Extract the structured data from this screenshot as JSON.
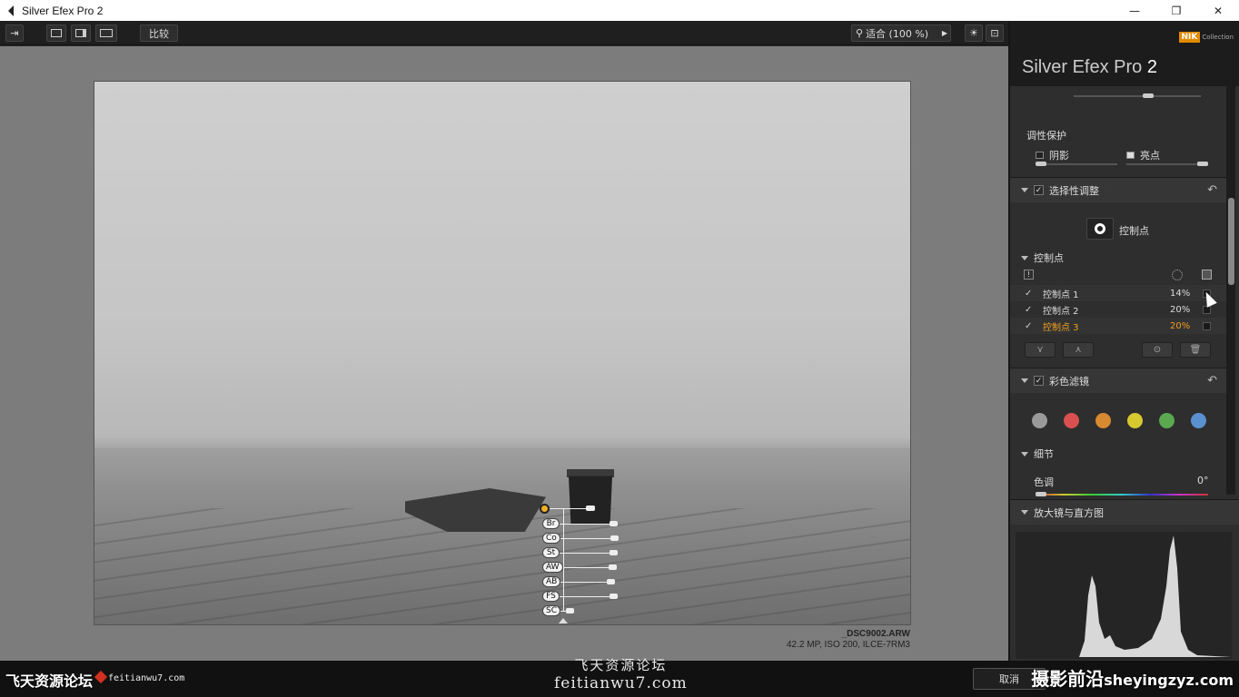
{
  "window": {
    "title": "Silver Efex Pro 2",
    "minimize": "—",
    "maximize": "❐",
    "close": "✕"
  },
  "toolbar": {
    "compare_label": "比较",
    "zoom_label": "适合 (100 %)"
  },
  "image": {
    "filename": "_DSC9002.ARW",
    "meta": "42.2 MP, ISO 200, ILCE-7RM3"
  },
  "control_point_overlay": {
    "labels": [
      "Br",
      "Co",
      "St",
      "AW",
      "AB",
      "FS",
      "SC"
    ]
  },
  "panel": {
    "brand": "Nik Collection",
    "brand_short": "NIK",
    "brand_coll": "Collection",
    "title_main": "Silver Efex Pro",
    "title_num": "2",
    "tone_protection": {
      "title": "调性保护",
      "shadow": "阴影",
      "highlight": "亮点"
    },
    "selective_adjust": {
      "title": "选择性调整",
      "button": "控制点"
    },
    "control_points": {
      "title": "控制点",
      "items": [
        {
          "name": "控制点 1",
          "pct": "14%",
          "color": "#dddddd"
        },
        {
          "name": "控制点 2",
          "pct": "20%",
          "color": "#dddddd"
        },
        {
          "name": "控制点 3",
          "pct": "20%",
          "color": "#f0a020"
        }
      ]
    },
    "color_filter": {
      "title": "彩色滤镜",
      "colors": [
        "#9a9a9a",
        "#d85050",
        "#d88a30",
        "#d8c830",
        "#5aa850",
        "#5a90d0"
      ]
    },
    "details": {
      "title": "细节",
      "hue_label": "色调",
      "hue_value": "0°"
    },
    "loupe": {
      "title": "放大镜与直方图"
    }
  },
  "bottom": {
    "cancel_label": "取消",
    "watermark_left": "飞天资源论坛",
    "watermark_site": "feitianwu7.com",
    "watermark_center_cn": "飞天资源论坛",
    "watermark_center_en": "feitianwu7.com",
    "watermark_right_cn": "摄影前沿",
    "watermark_right_en": "sheyingzyz.com"
  }
}
